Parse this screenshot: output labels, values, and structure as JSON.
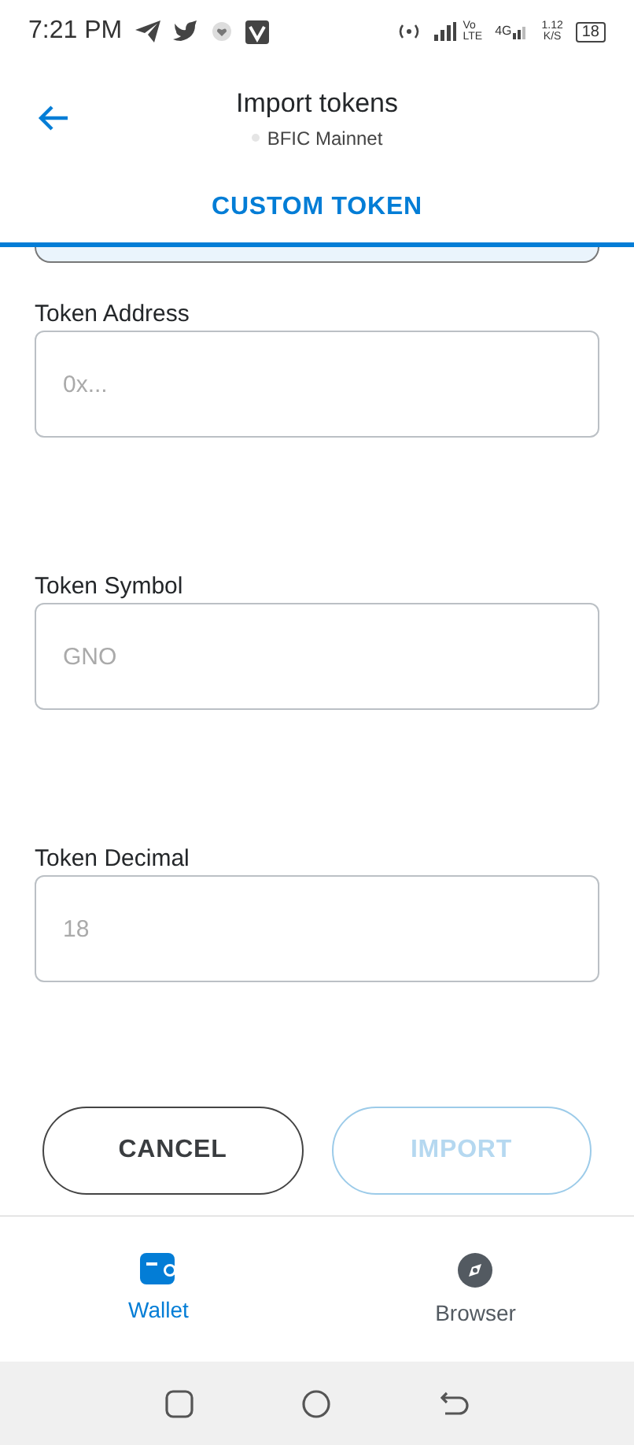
{
  "status_bar": {
    "time": "7:21 PM",
    "volte_top": "Vo",
    "volte_bottom": "LTE",
    "network": "4G",
    "speed": "1.12",
    "speed_unit": "K/S",
    "battery": "18"
  },
  "header": {
    "title": "Import tokens",
    "network": "BFIC Mainnet"
  },
  "tabs": [
    {
      "label": "CUSTOM TOKEN",
      "selected": true
    }
  ],
  "fields": [
    {
      "label": "Token Address",
      "placeholder": "0x..."
    },
    {
      "label": "Token Symbol",
      "placeholder": "GNO"
    },
    {
      "label": "Token Decimal",
      "placeholder": "18"
    }
  ],
  "buttons": [
    {
      "label": "CANCEL",
      "disabled": false
    },
    {
      "label": "IMPORT",
      "disabled": true
    }
  ],
  "nav": [
    {
      "label": "Wallet",
      "kind": "wallet",
      "selected": true
    },
    {
      "label": "Browser",
      "kind": "browser",
      "selected": false
    }
  ]
}
